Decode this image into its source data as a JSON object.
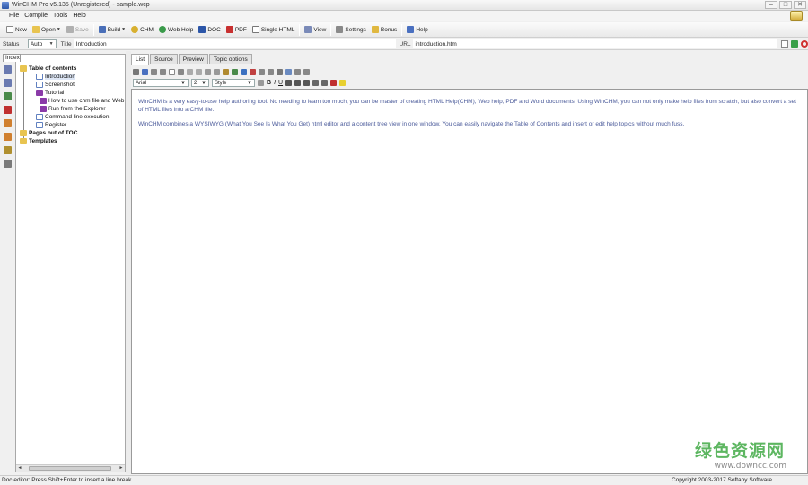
{
  "titlebar": {
    "title": "WinCHM Pro v5.135 (Unregistered) - sample.wcp"
  },
  "menu": [
    "File",
    "Compile",
    "Tools",
    "Help"
  ],
  "toolbar": {
    "new": "New",
    "open": "Open",
    "save": "Save",
    "build": "Build",
    "chm": "CHM",
    "webhelp": "Web Help",
    "doc": "DOC",
    "pdf": "PDF",
    "single_html": "Single HTML",
    "view": "View",
    "settings": "Settings",
    "bonus": "Bonus",
    "help": "Help"
  },
  "address": {
    "state_label": "Status",
    "state_value": "Auto",
    "title_label": "Title",
    "title_value": "Introduction",
    "url_label": "URL",
    "url_value": "introduction.htm"
  },
  "tree": {
    "tab": "Index",
    "nodes": [
      "Table of contents",
      "Introduction",
      "Screenshot",
      "Tutorial",
      "How to use chm file and Web Help",
      "Run from the Explorer",
      "Command line execution",
      "Register",
      "Pages out of TOC",
      "Templates"
    ]
  },
  "editor": {
    "tabs": [
      "List",
      "Source",
      "Preview",
      "Topic options"
    ],
    "font": "Arial",
    "size": "2",
    "style": "Style",
    "paragraphs": [
      "WinCHM is a very easy-to-use help authoring tool. No needing to learn too much, you can be master of creating HTML Help(CHM), Web help, PDF and Word documents. Using WinCHM, you can not only make help files from scratch, but also convert a set of HTML files into a CHM file.",
      "WinCHM combines a WYSIWYG (What You See Is What You Get) html editor and a content tree view in one window. You can easily navigate the Table of Contents and insert or edit help topics without much fuss."
    ]
  },
  "status": {
    "left": "Doc editor: Press Shift+Enter to insert a line break",
    "right": "Copyright 2003-2017 Softany Software"
  },
  "watermark": {
    "cn": "绿色资源网",
    "url": "www.downcc.com"
  },
  "colors": {
    "accent": "#2c56a8",
    "text_blue": "#4a5a9a",
    "watermark_green": "#4caf50"
  }
}
